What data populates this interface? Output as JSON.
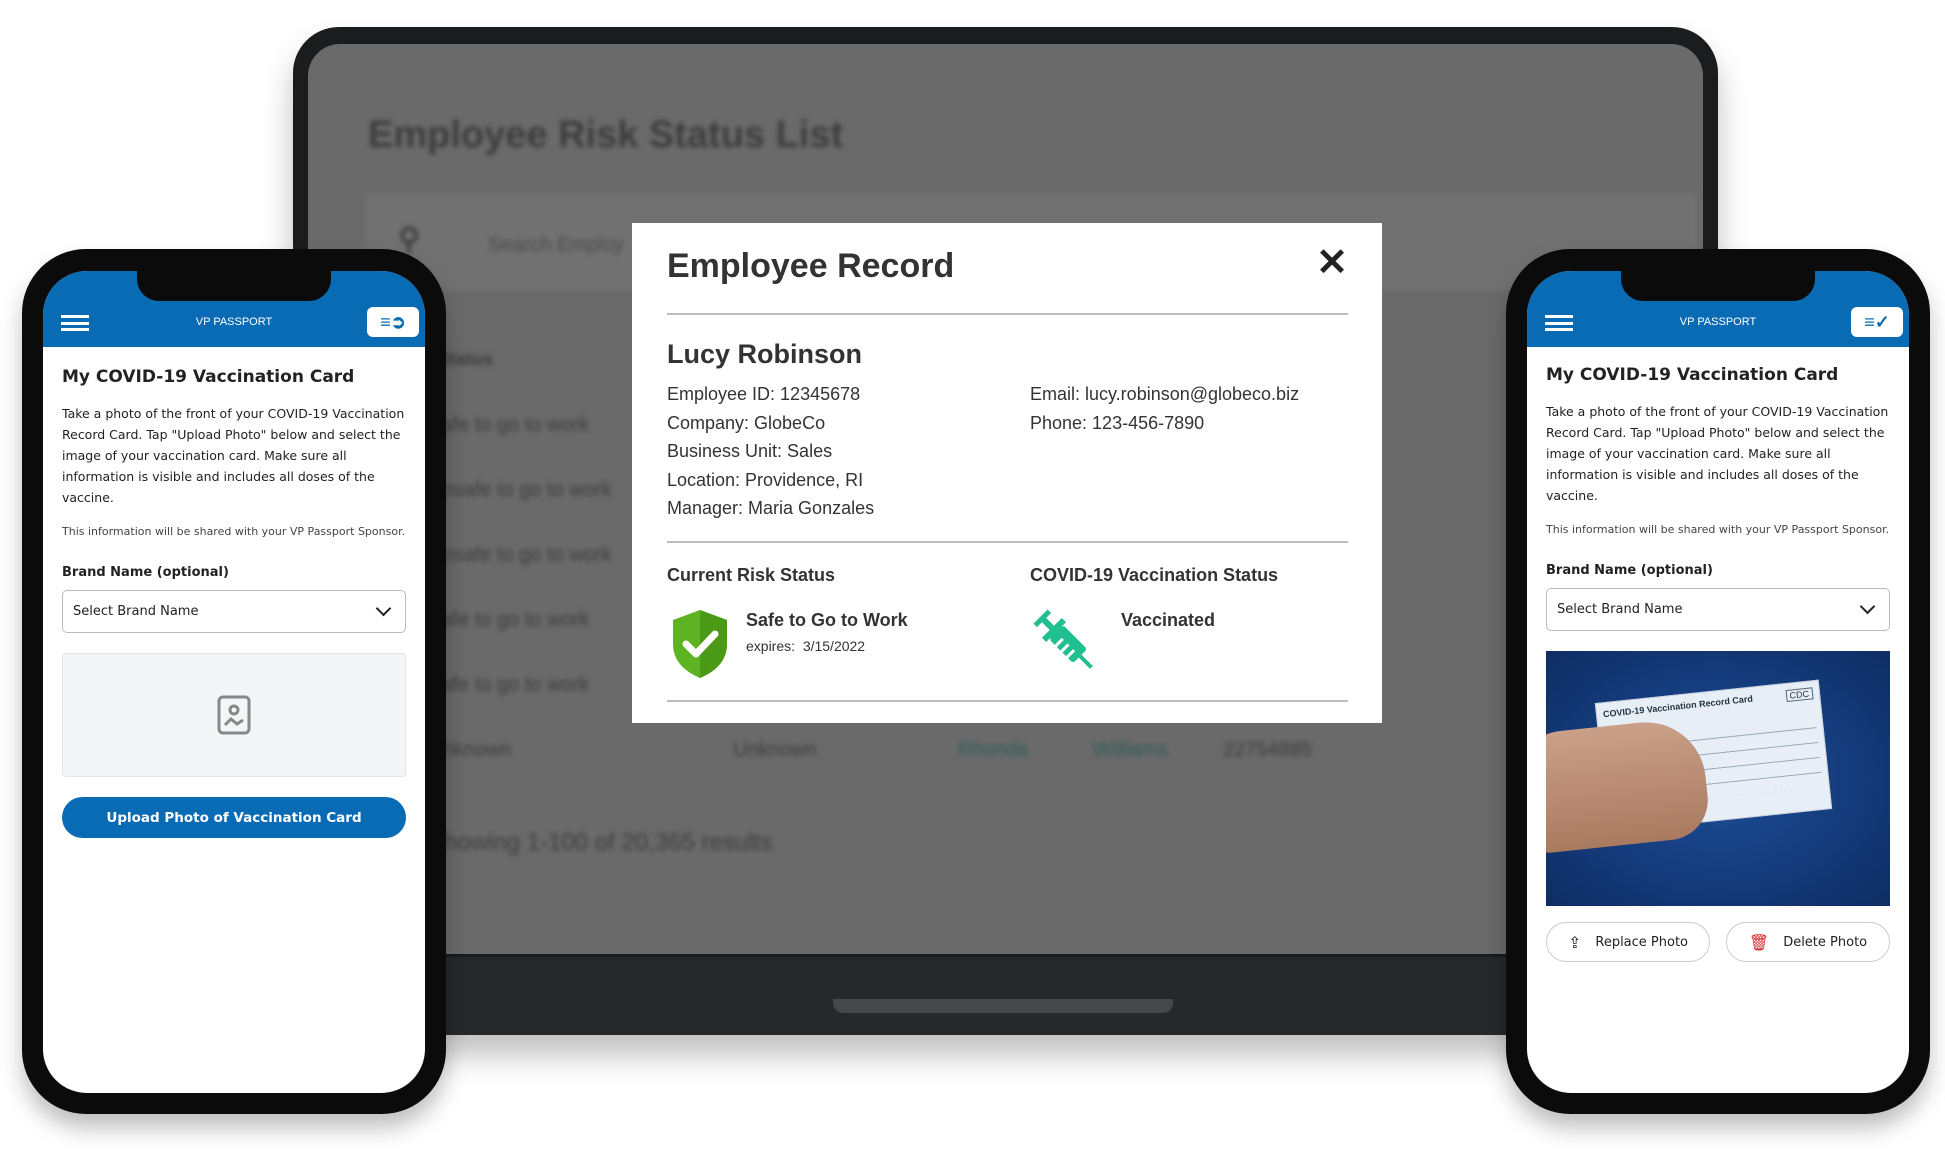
{
  "background_app": {
    "title": "Employee Risk Status List",
    "search_placeholder": "Search Employ",
    "status_header": "Status",
    "rows": [
      "Safe to go to work",
      "Unsafe to go to work",
      "Unsafe to go to work",
      "Safe to go to work",
      "Safe to go to work",
      "Unknown"
    ],
    "last_row": {
      "status": "Unknown",
      "first": "Rhonda",
      "last": "Williams",
      "id": "22754885"
    },
    "results_text": "Showing 1-100 of 20,365 results"
  },
  "modal": {
    "title": "Employee Record",
    "close_icon": "close-icon",
    "name": "Lucy Robinson",
    "left_fields": [
      "Employee ID: 12345678",
      "Company: GlobeCo",
      "Business Unit: Sales",
      "Location: Providence, RI",
      "Manager: Maria Gonzales"
    ],
    "right_fields": [
      "Email: lucy.robinson@globeco.biz",
      "Phone: 123-456-7890"
    ],
    "risk": {
      "heading": "Current Risk Status",
      "status": "Safe to Go to Work",
      "expires_label": "expires:",
      "expires": "3/15/2022",
      "color": "#5db322"
    },
    "vaccination": {
      "heading": "COVID-19 Vaccination Status",
      "status": "Vaccinated",
      "color": "#1fbf8f"
    }
  },
  "phone_left": {
    "brand": "VP PASSPORT",
    "title": "My COVID-19 Vaccination Card",
    "body": "Take a photo of the front of your COVID-19 Vaccination Record Card. Tap \"Upload Photo\" below and select the image of your vaccination card. Make sure all information is visible and includes all doses of the vaccine.",
    "note": "This information will be shared with your VP Passport Sponsor.",
    "brand_label": "Brand Name (optional)",
    "brand_select": "Select Brand Name",
    "upload_button": "Upload Photo of Vaccination Card"
  },
  "phone_right": {
    "brand": "VP PASSPORT",
    "title": "My COVID-19 Vaccination Card",
    "body": "Take a photo of the front of your COVID-19 Vaccination Record Card. Tap \"Upload Photo\" below and select the image of your vaccination card. Make sure all information is visible and includes all doses of the vaccine.",
    "note": "This information will be shared with your VP Passport Sponsor.",
    "brand_label": "Brand Name (optional)",
    "brand_select": "Select Brand Name",
    "photo_card_title": "COVID-19 Vaccination Record Card",
    "photo_card_logo": "CDC",
    "replace_button": "Replace Photo",
    "delete_button": "Delete Photo"
  },
  "colors": {
    "brand_blue": "#0a6bb5",
    "delete_red": "#d0262b"
  }
}
